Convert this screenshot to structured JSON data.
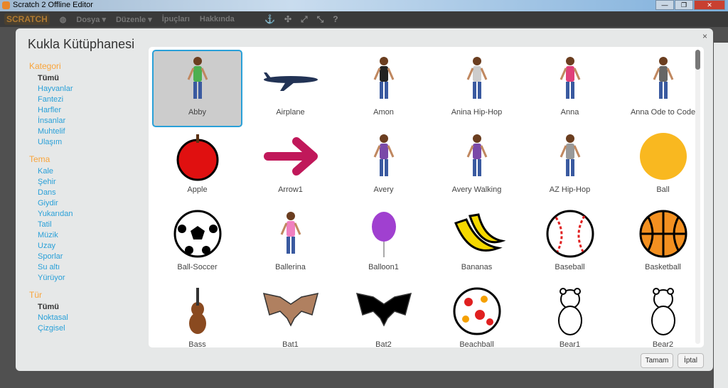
{
  "window": {
    "title": "Scratch 2 Offline Editor",
    "controls": [
      "—",
      "❐",
      "✕"
    ]
  },
  "menubar": {
    "logo": "SCRATCH",
    "items": [
      "Dosya ▾",
      "Düzenle ▾",
      "İpuçları",
      "Hakkında"
    ],
    "tools": [
      "⚓",
      "✣",
      "⤢",
      "⤡",
      "?"
    ]
  },
  "dialog": {
    "title": "Kukla Kütüphanesi",
    "close": "×",
    "ok": "Tamam",
    "cancel": "İptal"
  },
  "sidebar": {
    "sections": [
      {
        "title": "Kategori",
        "items": [
          "Tümü",
          "Hayvanlar",
          "Fantezi",
          "Harfler",
          "İnsanlar",
          "Muhtelif",
          "Ulaşım"
        ],
        "selected": 0
      },
      {
        "title": "Tema",
        "items": [
          "Kale",
          "Şehir",
          "Dans",
          "Giydir",
          "Yukarıdan",
          "Tatil",
          "Müzik",
          "Uzay",
          "Sporlar",
          "Su altı",
          "Yürüyor"
        ],
        "selected": -1
      },
      {
        "title": "Tür",
        "items": [
          "Tümü",
          "Noktasal",
          "Çizgisel"
        ],
        "selected": 0
      }
    ]
  },
  "sprites": [
    {
      "name": "Abby",
      "icon": "person",
      "color": "#4caf50"
    },
    {
      "name": "Airplane",
      "icon": "airplane",
      "color": "#223355"
    },
    {
      "name": "Amon",
      "icon": "person",
      "color": "#222"
    },
    {
      "name": "Anina Hip-Hop",
      "icon": "person",
      "color": "#ccc"
    },
    {
      "name": "Anna",
      "icon": "person",
      "color": "#e0407a"
    },
    {
      "name": "Anna Ode to Code",
      "icon": "person",
      "color": "#666"
    },
    {
      "name": "Apple",
      "icon": "apple",
      "color": "#e01010"
    },
    {
      "name": "Arrow1",
      "icon": "arrow",
      "color": "#c0185a"
    },
    {
      "name": "Avery",
      "icon": "person",
      "color": "#7a4aa8"
    },
    {
      "name": "Avery Walking",
      "icon": "person",
      "color": "#7a4aa8"
    },
    {
      "name": "AZ Hip-Hop",
      "icon": "person",
      "color": "#999"
    },
    {
      "name": "Ball",
      "icon": "ball",
      "color": "#f9b820"
    },
    {
      "name": "Ball-Soccer",
      "icon": "soccer",
      "color": "#000"
    },
    {
      "name": "Ballerina",
      "icon": "person",
      "color": "#f080c0"
    },
    {
      "name": "Balloon1",
      "icon": "balloon",
      "color": "#a040d0"
    },
    {
      "name": "Bananas",
      "icon": "bananas",
      "color": "#f5d800"
    },
    {
      "name": "Baseball",
      "icon": "baseball",
      "color": "#e02020"
    },
    {
      "name": "Basketball",
      "icon": "basketball",
      "color": "#f39020"
    },
    {
      "name": "Bass",
      "icon": "bass",
      "color": "#8a4a20"
    },
    {
      "name": "Bat1",
      "icon": "bat",
      "color": "#b08060"
    },
    {
      "name": "Bat2",
      "icon": "bat",
      "color": "#000"
    },
    {
      "name": "Beachball",
      "icon": "beachball",
      "color": "#e02020"
    },
    {
      "name": "Bear1",
      "icon": "bear",
      "color": "#fff"
    },
    {
      "name": "Bear2",
      "icon": "bear",
      "color": "#fff"
    }
  ],
  "selected_sprite": 0
}
